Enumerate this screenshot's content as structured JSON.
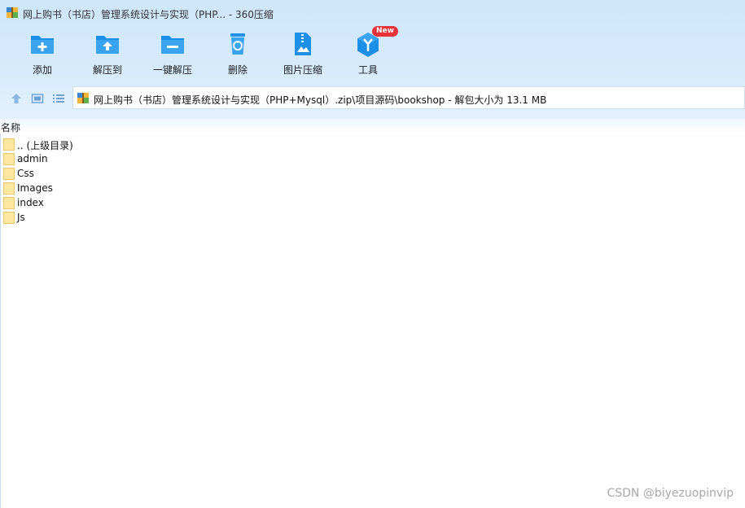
{
  "window": {
    "title": "网上购书（书店）管理系统设计与实现（PHP... - 360压缩"
  },
  "toolbar": {
    "items": [
      {
        "label": "添加",
        "icon": "add-folder-icon"
      },
      {
        "label": "解压到",
        "icon": "extract-to-icon"
      },
      {
        "label": "一键解压",
        "icon": "one-click-extract-icon"
      },
      {
        "label": "删除",
        "icon": "trash-icon"
      },
      {
        "label": "图片压缩",
        "icon": "image-compress-icon"
      },
      {
        "label": "工具",
        "icon": "tools-icon",
        "badge": "New"
      }
    ]
  },
  "navbar": {
    "path": "网上购书（书店）管理系统设计与实现（PHP+Mysql）.zip\\项目源码\\bookshop - 解包大小为 13.1 MB"
  },
  "list": {
    "header": "名称",
    "rows": [
      {
        "name": ".. (上级目录)"
      },
      {
        "name": "admin"
      },
      {
        "name": "Css"
      },
      {
        "name": "Images"
      },
      {
        "name": "index"
      },
      {
        "name": "Js"
      }
    ]
  },
  "watermark": "CSDN @biyezuopinvip",
  "colors": {
    "accent": "#1e8fe6",
    "chrome_bg": "#d3e8fb",
    "folder": "#fde7a1",
    "badge": "#e8323a"
  }
}
